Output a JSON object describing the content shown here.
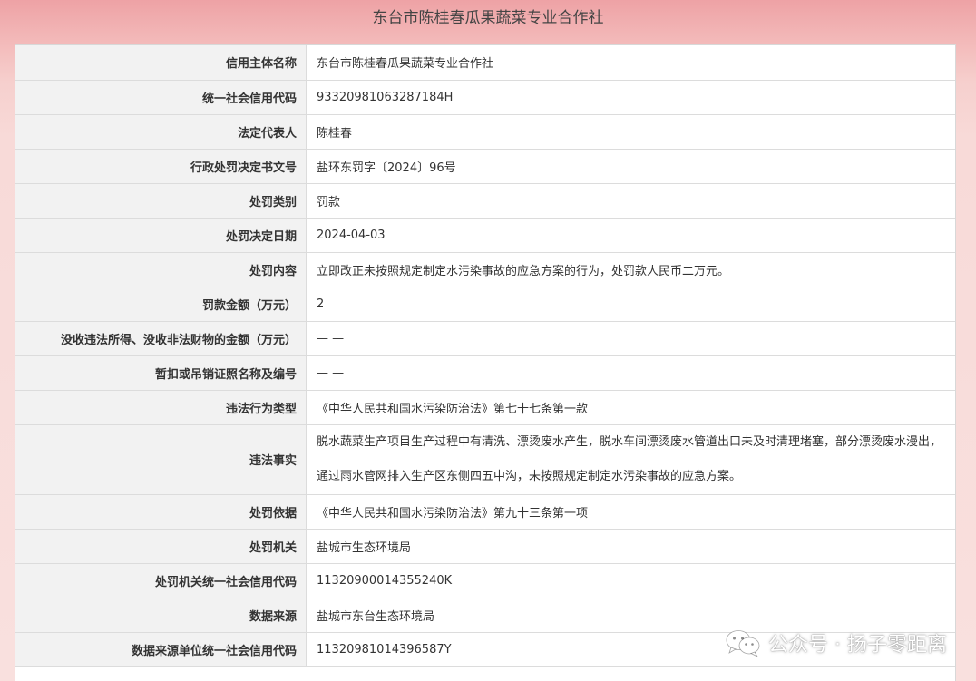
{
  "header": {
    "title": "东台市陈桂春瓜果蔬菜专业合作社"
  },
  "rows": [
    {
      "label": "信用主体名称",
      "value": "东台市陈桂春瓜果蔬菜专业合作社"
    },
    {
      "label": "统一社会信用代码",
      "value": "93320981063287184H"
    },
    {
      "label": "法定代表人",
      "value": "陈桂春"
    },
    {
      "label": "行政处罚决定书文号",
      "value": "盐环东罚字〔2024〕96号"
    },
    {
      "label": "处罚类别",
      "value": "罚款"
    },
    {
      "label": "处罚决定日期",
      "value": "2024-04-03"
    },
    {
      "label": "处罚内容",
      "value": "立即改正未按照规定制定水污染事故的应急方案的行为，处罚款人民币二万元。"
    },
    {
      "label": "罚款金额（万元）",
      "value": "2"
    },
    {
      "label": "没收违法所得、没收非法财物的金额（万元）",
      "value": "— —"
    },
    {
      "label": "暂扣或吊销证照名称及编号",
      "value": "— —"
    },
    {
      "label": "违法行为类型",
      "value": "《中华人民共和国水污染防治法》第七十七条第一款"
    },
    {
      "label": "违法事实",
      "value": "脱水蔬菜生产项目生产过程中有清洗、漂烫废水产生，脱水车间漂烫废水管道出口未及时清理堵塞，部分漂烫废水漫出，通过雨水管网排入生产区东侧四五中沟，未按照规定制定水污染事故的应急方案。"
    },
    {
      "label": "处罚依据",
      "value": "《中华人民共和国水污染防治法》第九十三条第一项"
    },
    {
      "label": "处罚机关",
      "value": "盐城市生态环境局"
    },
    {
      "label": "处罚机关统一社会信用代码",
      "value": "11320900014355240K"
    },
    {
      "label": "数据来源",
      "value": "盐城市东台生态环境局"
    },
    {
      "label": "数据来源单位统一社会信用代码",
      "value": "11320981014396587Y"
    }
  ],
  "watermark": {
    "icon": "wechat-icon",
    "text": "公众号 · 扬子零距离"
  }
}
